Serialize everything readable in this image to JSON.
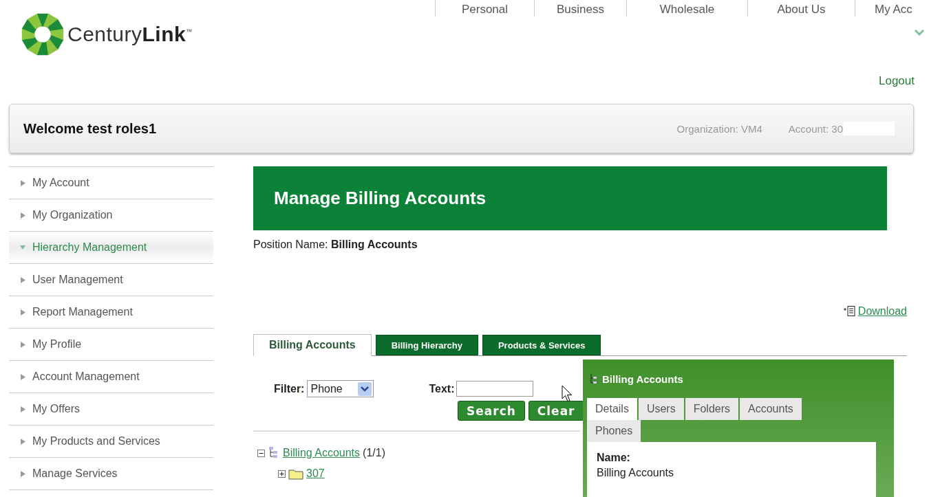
{
  "logo": {
    "light": "Century",
    "bold": "Link",
    "mark": "™"
  },
  "top_nav": [
    {
      "label": "Personal"
    },
    {
      "label": "Business"
    },
    {
      "label": "Wholesale"
    },
    {
      "label": "About Us"
    },
    {
      "label": "My Acc"
    }
  ],
  "logout": "Logout",
  "welcome": {
    "greeting": "Welcome test roles1",
    "organization": "Organization: VM4",
    "account": "Account: 30"
  },
  "sidebar": {
    "items": [
      {
        "label": "My Account",
        "selected": false
      },
      {
        "label": "My Organization",
        "selected": false
      },
      {
        "label": "Hierarchy Management",
        "selected": true
      },
      {
        "label": "User Management",
        "selected": false
      },
      {
        "label": "Report Management",
        "selected": false
      },
      {
        "label": "My Profile",
        "selected": false
      },
      {
        "label": "Account Management",
        "selected": false
      },
      {
        "label": "My Offers",
        "selected": false
      },
      {
        "label": "My Products and Services",
        "selected": false
      },
      {
        "label": "Manage Services",
        "selected": false
      }
    ]
  },
  "page_title": "Manage Billing Accounts",
  "position": {
    "label": "Position Name:",
    "value": "Billing Accounts"
  },
  "download": "Download",
  "tabs": [
    {
      "label": "Billing Accounts",
      "selected": true
    },
    {
      "label": "Billing Hierarchy",
      "selected": false
    },
    {
      "label": "Products & Services",
      "selected": false
    }
  ],
  "filter": {
    "label": "Filter:",
    "value": "Phone"
  },
  "text_field": {
    "label": "Text:"
  },
  "buttons": [
    "Search",
    "Clear"
  ],
  "tree": [
    {
      "label": "Billing Accounts",
      "count": "(1/1)",
      "kind": "hierarchy",
      "expanded": true,
      "children": [
        {
          "label": "307",
          "kind": "folder",
          "expanded": false
        }
      ]
    }
  ],
  "details_popup": {
    "title": "Billing Accounts",
    "tabs": [
      {
        "label": "Details",
        "selected": true
      },
      {
        "label": "Users",
        "selected": false
      },
      {
        "label": "Folders",
        "selected": false
      },
      {
        "label": "Accounts",
        "selected": false
      },
      {
        "label": "Phones",
        "selected": false
      }
    ],
    "fields": [
      {
        "label": "Name:",
        "value": "Billing Accounts"
      }
    ]
  }
}
